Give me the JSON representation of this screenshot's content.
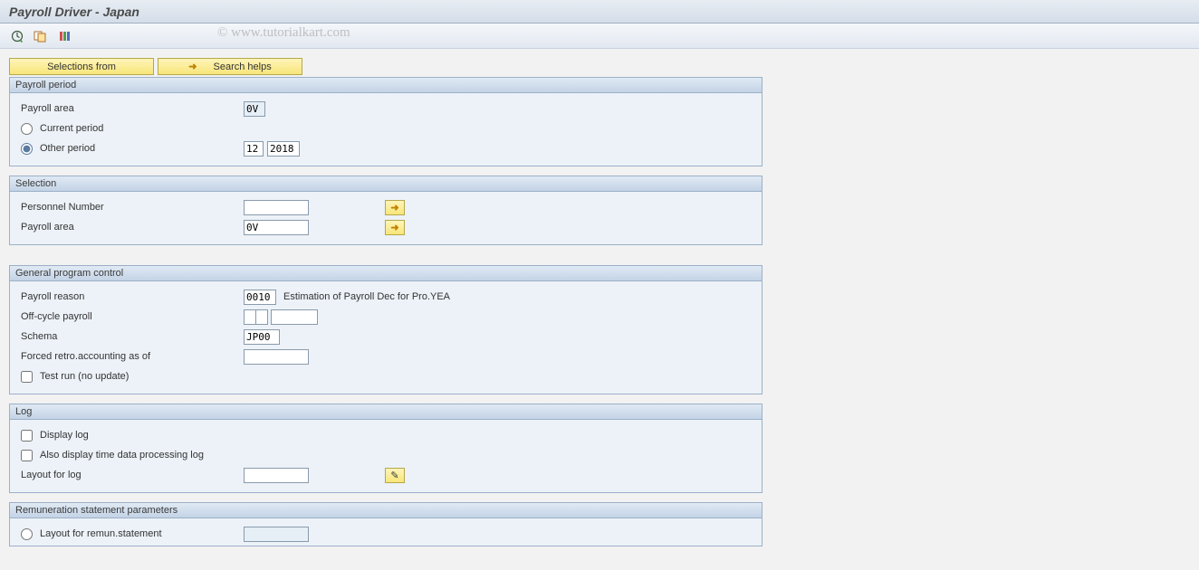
{
  "title": "Payroll Driver - Japan",
  "toolbar": {
    "icons": {
      "execute": "clock-execute-icon",
      "variants": "variants-icon",
      "jobs": "jobs-icon"
    }
  },
  "watermark": "© www.tutorialkart.com",
  "buttons": {
    "selections_from": "Selections from",
    "search_helps": "Search helps"
  },
  "groups": {
    "payroll_period": {
      "title": "Payroll period",
      "payroll_area_label": "Payroll area",
      "payroll_area_value": "0V",
      "current_period_label": "Current period",
      "other_period_label": "Other period",
      "other_period_month": "12",
      "other_period_year": "2018"
    },
    "selection": {
      "title": "Selection",
      "personnel_number_label": "Personnel Number",
      "personnel_number_value": "",
      "payroll_area_label": "Payroll area",
      "payroll_area_value": "0V"
    },
    "general": {
      "title": "General program control",
      "payroll_reason_label": "Payroll reason",
      "payroll_reason_code": "0010",
      "payroll_reason_desc": "Estimation of Payroll Dec for Pro.YEA",
      "offcycle_label": "Off-cycle payroll",
      "offcycle_a": "",
      "offcycle_b": "",
      "offcycle_c": "",
      "schema_label": "Schema",
      "schema_value": "JP00",
      "forced_retro_label": "Forced retro.accounting as of",
      "forced_retro_value": "",
      "test_run_label": "Test run (no update)"
    },
    "log": {
      "title": "Log",
      "display_log_label": "Display log",
      "also_display_label": "Also display time data processing log",
      "layout_label": "Layout for log",
      "layout_value": ""
    },
    "remuneration": {
      "title": "Remuneration statement parameters",
      "layout_remun_label": "Layout for remun.statement",
      "layout_remun_value": ""
    }
  }
}
